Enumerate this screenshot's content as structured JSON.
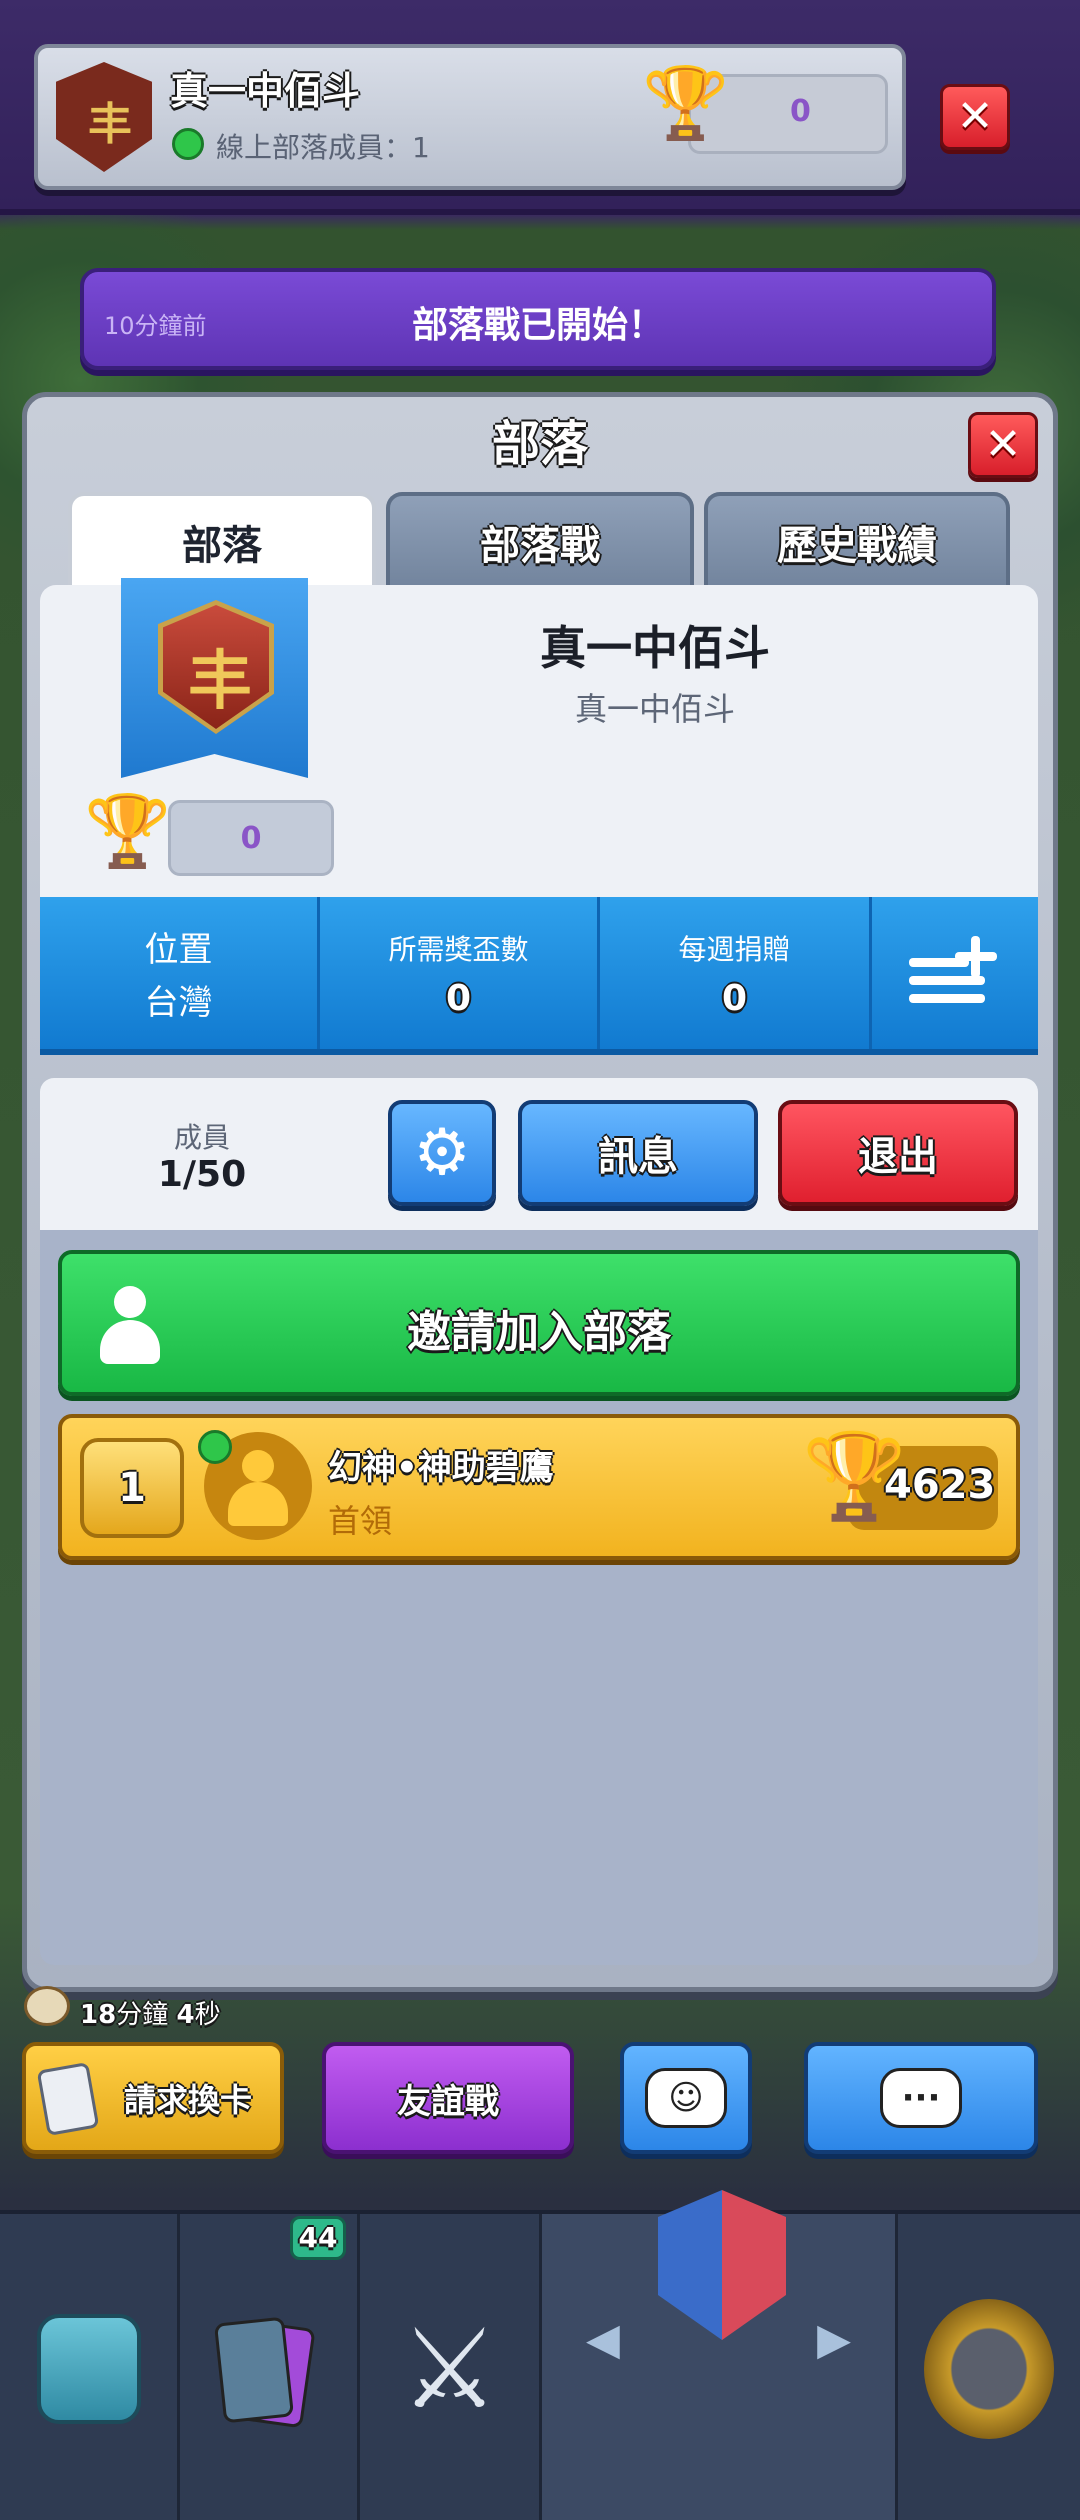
{
  "top_clan_card": {
    "clan_name": "真一中佰斗",
    "online_label": "線上部落成員：1",
    "trophy_value": "0"
  },
  "notice": {
    "time": "10分鐘前",
    "message": "部落戰已開始！"
  },
  "panel": {
    "title": "部落",
    "tabs": [
      {
        "label": "部落",
        "selected": true
      },
      {
        "label": "部落戰",
        "selected": false
      },
      {
        "label": "歷史戰績",
        "selected": false
      }
    ],
    "clan_name": "真一中佰斗",
    "clan_description": "真一中佰斗",
    "clan_trophies": "0",
    "stats": {
      "location_label": "位置",
      "location_value": "台灣",
      "required_trophies_label": "所需獎盃數",
      "required_trophies_value": "0",
      "weekly_donations_label": "每週捐贈",
      "weekly_donations_value": "0"
    },
    "members": {
      "label": "成員",
      "count": "1/50",
      "message_button": "訊息",
      "leave_button": "退出"
    },
    "invite_button": "邀請加入部落",
    "member_list": [
      {
        "rank": "1",
        "name": "幻神•神助碧鷹",
        "role": "首領",
        "trophies": "4623",
        "online": true
      }
    ]
  },
  "bottom": {
    "timer_minutes": "18",
    "timer_min_unit": "分鐘",
    "timer_seconds": "4",
    "timer_sec_unit": "秒",
    "request_cards_button": "請求換卡",
    "friendly_battle_button": "友誼戰",
    "card_badge_count": "44"
  },
  "icons": {
    "close": "close-icon",
    "settings": "gear-icon",
    "trophy": "trophy-icon",
    "emote": "emote-icon",
    "chat": "chat-icon"
  },
  "colors": {
    "clan_purple": "#6a3fc8",
    "action_blue": "#2c86e8",
    "leave_red": "#e0202f",
    "invite_green": "#19b845",
    "member_gold": "#f2b31f"
  }
}
